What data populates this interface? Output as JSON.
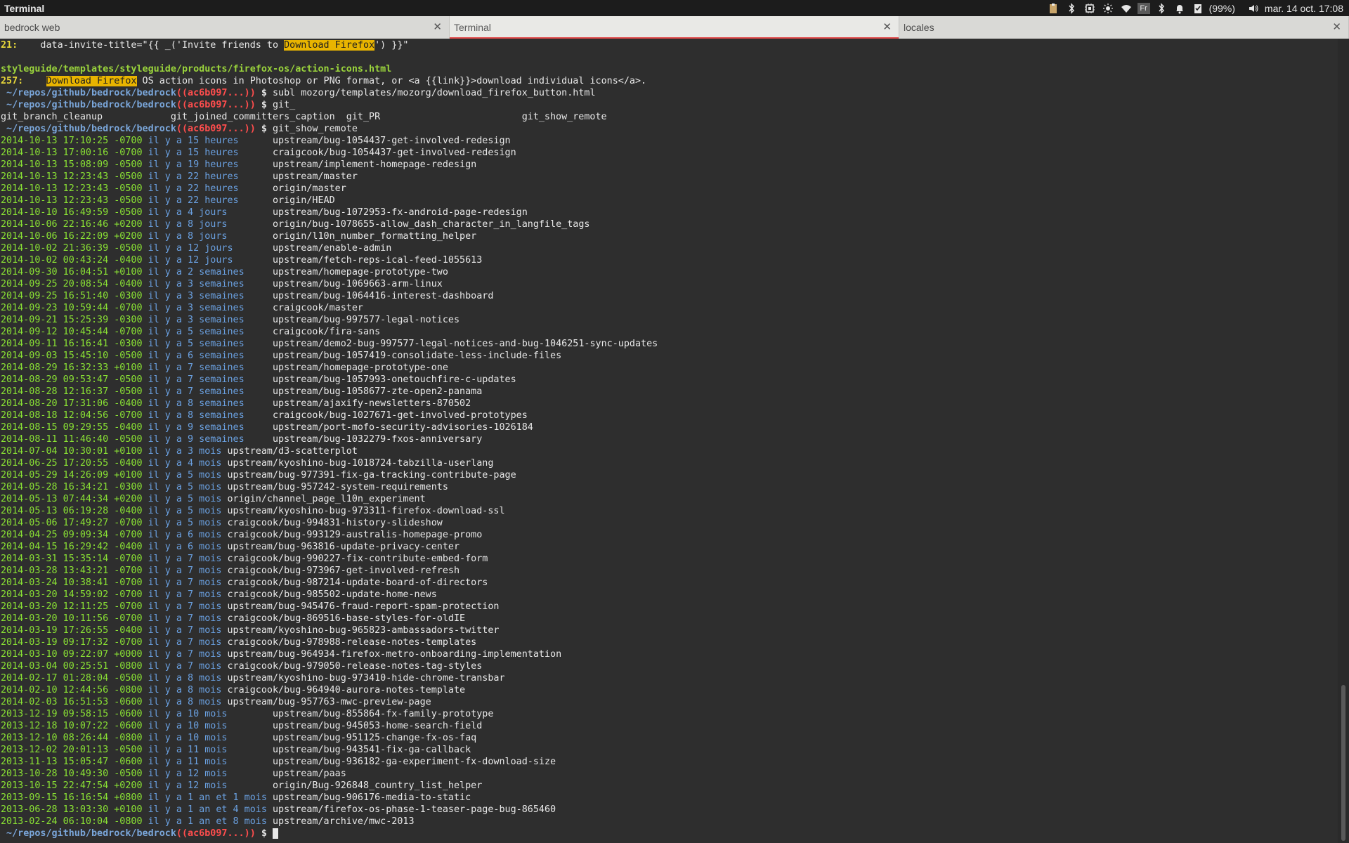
{
  "window": {
    "title": "Terminal"
  },
  "tray": {
    "battery": "(99%)",
    "datetime": "mar. 14 oct. 17:08",
    "keyboard_label": "Fr",
    "icons": [
      "clipboard-icon",
      "bluetooth-icon",
      "cpu-icon",
      "brightness-icon",
      "wifi-icon",
      "keyboard-layout-icon",
      "bluetooth-icon",
      "bell-icon",
      "checklist-icon",
      "battery-text",
      "volume-icon"
    ]
  },
  "tabs": [
    {
      "label": "bedrock web",
      "active": false
    },
    {
      "label": "Terminal",
      "active": true
    },
    {
      "label": "locales",
      "active": false
    }
  ],
  "terminal": {
    "lines": [
      {
        "kind": "grep",
        "num": "21:",
        "pre": "    data-invite-title=\"{{ _('Invite friends to ",
        "hl": "Download Firefox",
        "post": "') }}\""
      },
      {
        "kind": "blank"
      },
      {
        "kind": "file",
        "text": "styleguide/templates/styleguide/products/firefox-os/action-icons.html"
      },
      {
        "kind": "grep",
        "num": "257:",
        "pre": "    ",
        "hl": "Download Firefox",
        "post": " OS action icons in Photoshop or PNG format, or <a {{link}}>download individual icons</a>."
      },
      {
        "kind": "prompt",
        "path": " ~/repos/github/bedrock/bedrock",
        "branch": "((ac6b097...))",
        "cmd": " subl mozorg/templates/mozorg/download_firefox_button.html"
      },
      {
        "kind": "prompt",
        "path": " ~/repos/github/bedrock/bedrock",
        "branch": "((ac6b097...))",
        "cmd": " git_"
      },
      {
        "kind": "plain",
        "text": "git_branch_cleanup            git_joined_committers_caption  git_PR                         git_show_remote"
      },
      {
        "kind": "prompt",
        "path": " ~/repos/github/bedrock/bedrock",
        "branch": "((ac6b097...))",
        "cmd": " git_show_remote"
      },
      {
        "kind": "ref",
        "date": "2014-10-13 17:10:25 -0700",
        "rel": "il y a 15 heures",
        "pad": "      ",
        "branch": "upstream/bug-1054437-get-involved-redesign"
      },
      {
        "kind": "ref",
        "date": "2014-10-13 17:00:16 -0700",
        "rel": "il y a 15 heures",
        "pad": "      ",
        "branch": "craigcook/bug-1054437-get-involved-redesign"
      },
      {
        "kind": "ref",
        "date": "2014-10-13 15:08:09 -0500",
        "rel": "il y a 19 heures",
        "pad": "      ",
        "branch": "upstream/implement-homepage-redesign"
      },
      {
        "kind": "ref",
        "date": "2014-10-13 12:23:43 -0500",
        "rel": "il y a 22 heures",
        "pad": "      ",
        "branch": "upstream/master"
      },
      {
        "kind": "ref",
        "date": "2014-10-13 12:23:43 -0500",
        "rel": "il y a 22 heures",
        "pad": "      ",
        "branch": "origin/master"
      },
      {
        "kind": "ref",
        "date": "2014-10-13 12:23:43 -0500",
        "rel": "il y a 22 heures",
        "pad": "      ",
        "branch": "origin/HEAD"
      },
      {
        "kind": "ref",
        "date": "2014-10-10 16:49:59 -0500",
        "rel": "il y a 4 jours",
        "pad": "        ",
        "branch": "upstream/bug-1072953-fx-android-page-redesign"
      },
      {
        "kind": "ref",
        "date": "2014-10-06 22:16:46 +0200",
        "rel": "il y a 8 jours",
        "pad": "        ",
        "branch": "origin/bug-1078655-allow_dash_character_in_langfile_tags"
      },
      {
        "kind": "ref",
        "date": "2014-10-06 16:22:09 +0200",
        "rel": "il y a 8 jours",
        "pad": "        ",
        "branch": "origin/l10n_number_formatting_helper"
      },
      {
        "kind": "ref",
        "date": "2014-10-02 21:36:39 -0500",
        "rel": "il y a 12 jours",
        "pad": "       ",
        "branch": "upstream/enable-admin"
      },
      {
        "kind": "ref",
        "date": "2014-10-02 00:43:24 -0400",
        "rel": "il y a 12 jours",
        "pad": "       ",
        "branch": "upstream/fetch-reps-ical-feed-1055613"
      },
      {
        "kind": "ref",
        "date": "2014-09-30 16:04:51 +0100",
        "rel": "il y a 2 semaines",
        "pad": "     ",
        "branch": "upstream/homepage-prototype-two"
      },
      {
        "kind": "ref",
        "date": "2014-09-25 20:08:54 -0400",
        "rel": "il y a 3 semaines",
        "pad": "     ",
        "branch": "upstream/bug-1069663-arm-linux"
      },
      {
        "kind": "ref",
        "date": "2014-09-25 16:51:40 -0300",
        "rel": "il y a 3 semaines",
        "pad": "     ",
        "branch": "upstream/bug-1064416-interest-dashboard"
      },
      {
        "kind": "ref",
        "date": "2014-09-23 10:59:44 -0700",
        "rel": "il y a 3 semaines",
        "pad": "     ",
        "branch": "craigcook/master"
      },
      {
        "kind": "ref",
        "date": "2014-09-21 15:25:39 -0300",
        "rel": "il y a 3 semaines",
        "pad": "     ",
        "branch": "upstream/bug-997577-legal-notices"
      },
      {
        "kind": "ref",
        "date": "2014-09-12 10:45:44 -0700",
        "rel": "il y a 5 semaines",
        "pad": "     ",
        "branch": "craigcook/fira-sans"
      },
      {
        "kind": "ref",
        "date": "2014-09-11 16:16:41 -0300",
        "rel": "il y a 5 semaines",
        "pad": "     ",
        "branch": "upstream/demo2-bug-997577-legal-notices-and-bug-1046251-sync-updates"
      },
      {
        "kind": "ref",
        "date": "2014-09-03 15:45:10 -0500",
        "rel": "il y a 6 semaines",
        "pad": "     ",
        "branch": "upstream/bug-1057419-consolidate-less-include-files"
      },
      {
        "kind": "ref",
        "date": "2014-08-29 16:32:33 +0100",
        "rel": "il y a 7 semaines",
        "pad": "     ",
        "branch": "upstream/homepage-prototype-one"
      },
      {
        "kind": "ref",
        "date": "2014-08-29 09:53:47 -0500",
        "rel": "il y a 7 semaines",
        "pad": "     ",
        "branch": "upstream/bug-1057993-onetouchfire-c-updates"
      },
      {
        "kind": "ref",
        "date": "2014-08-28 12:16:37 -0500",
        "rel": "il y a 7 semaines",
        "pad": "     ",
        "branch": "upstream/bug-1058677-zte-open2-panama"
      },
      {
        "kind": "ref",
        "date": "2014-08-20 17:31:06 -0400",
        "rel": "il y a 8 semaines",
        "pad": "     ",
        "branch": "upstream/ajaxify-newsletters-870502"
      },
      {
        "kind": "ref",
        "date": "2014-08-18 12:04:56 -0700",
        "rel": "il y a 8 semaines",
        "pad": "     ",
        "branch": "craigcook/bug-1027671-get-involved-prototypes"
      },
      {
        "kind": "ref",
        "date": "2014-08-15 09:29:55 -0400",
        "rel": "il y a 9 semaines",
        "pad": "     ",
        "branch": "upstream/port-mofo-security-advisories-1026184"
      },
      {
        "kind": "ref",
        "date": "2014-08-11 11:46:40 -0500",
        "rel": "il y a 9 semaines",
        "pad": "     ",
        "branch": "upstream/bug-1032279-fxos-anniversary"
      },
      {
        "kind": "ref",
        "date": "2014-07-04 10:30:01 +0100",
        "rel": "il y a 3 mois",
        "pad": " ",
        "branch": "upstream/d3-scatterplot"
      },
      {
        "kind": "ref",
        "date": "2014-06-25 17:20:55 -0400",
        "rel": "il y a 4 mois",
        "pad": " ",
        "branch": "upstream/kyoshino-bug-1018724-tabzilla-userlang"
      },
      {
        "kind": "ref",
        "date": "2014-05-29 14:26:09 +0100",
        "rel": "il y a 5 mois",
        "pad": " ",
        "branch": "upstream/bug-977391-fix-ga-tracking-contribute-page"
      },
      {
        "kind": "ref",
        "date": "2014-05-28 16:34:21 -0300",
        "rel": "il y a 5 mois",
        "pad": " ",
        "branch": "upstream/bug-957242-system-requirements"
      },
      {
        "kind": "ref",
        "date": "2014-05-13 07:44:34 +0200",
        "rel": "il y a 5 mois",
        "pad": " ",
        "branch": "origin/channel_page_l10n_experiment"
      },
      {
        "kind": "ref",
        "date": "2014-05-13 06:19:28 -0400",
        "rel": "il y a 5 mois",
        "pad": " ",
        "branch": "upstream/kyoshino-bug-973311-firefox-download-ssl"
      },
      {
        "kind": "ref",
        "date": "2014-05-06 17:49:27 -0700",
        "rel": "il y a 5 mois",
        "pad": " ",
        "branch": "craigcook/bug-994831-history-slideshow"
      },
      {
        "kind": "ref",
        "date": "2014-04-25 09:09:34 -0700",
        "rel": "il y a 6 mois",
        "pad": " ",
        "branch": "craigcook/bug-993129-australis-homepage-promo"
      },
      {
        "kind": "ref",
        "date": "2014-04-15 16:29:42 -0400",
        "rel": "il y a 6 mois",
        "pad": " ",
        "branch": "upstream/bug-963816-update-privacy-center"
      },
      {
        "kind": "ref",
        "date": "2014-03-31 15:35:14 -0700",
        "rel": "il y a 7 mois",
        "pad": " ",
        "branch": "craigcook/bug-990227-fix-contribute-embed-form"
      },
      {
        "kind": "ref",
        "date": "2014-03-28 13:43:21 -0700",
        "rel": "il y a 7 mois",
        "pad": " ",
        "branch": "craigcook/bug-973967-get-involved-refresh"
      },
      {
        "kind": "ref",
        "date": "2014-03-24 10:38:41 -0700",
        "rel": "il y a 7 mois",
        "pad": " ",
        "branch": "craigcook/bug-987214-update-board-of-directors"
      },
      {
        "kind": "ref",
        "date": "2014-03-20 14:59:02 -0700",
        "rel": "il y a 7 mois",
        "pad": " ",
        "branch": "craigcook/bug-985502-update-home-news"
      },
      {
        "kind": "ref",
        "date": "2014-03-20 12:11:25 -0700",
        "rel": "il y a 7 mois",
        "pad": " ",
        "branch": "upstream/bug-945476-fraud-report-spam-protection"
      },
      {
        "kind": "ref",
        "date": "2014-03-20 10:11:56 -0700",
        "rel": "il y a 7 mois",
        "pad": " ",
        "branch": "craigcook/bug-869516-base-styles-for-oldIE"
      },
      {
        "kind": "ref",
        "date": "2014-03-19 17:26:55 -0400",
        "rel": "il y a 7 mois",
        "pad": " ",
        "branch": "upstream/kyoshino-bug-965823-ambassadors-twitter"
      },
      {
        "kind": "ref",
        "date": "2014-03-19 09:17:32 -0700",
        "rel": "il y a 7 mois",
        "pad": " ",
        "branch": "craigcook/bug-978988-release-notes-templates"
      },
      {
        "kind": "ref",
        "date": "2014-03-10 09:22:07 +0000",
        "rel": "il y a 7 mois",
        "pad": " ",
        "branch": "upstream/bug-964934-firefox-metro-onboarding-implementation"
      },
      {
        "kind": "ref",
        "date": "2014-03-04 00:25:51 -0800",
        "rel": "il y a 7 mois",
        "pad": " ",
        "branch": "craigcook/bug-979050-release-notes-tag-styles"
      },
      {
        "kind": "ref",
        "date": "2014-02-17 01:28:04 -0500",
        "rel": "il y a 8 mois",
        "pad": " ",
        "branch": "upstream/kyoshino-bug-973410-hide-chrome-transbar"
      },
      {
        "kind": "ref",
        "date": "2014-02-10 12:44:56 -0800",
        "rel": "il y a 8 mois",
        "pad": " ",
        "branch": "craigcook/bug-964940-aurora-notes-template"
      },
      {
        "kind": "ref",
        "date": "2014-02-03 16:51:53 -0600",
        "rel": "il y a 8 mois",
        "pad": " ",
        "branch": "upstream/bug-957763-mwc-preview-page"
      },
      {
        "kind": "ref",
        "date": "2013-12-19 09:58:15 -0600",
        "rel": "il y a 10 mois",
        "pad": "        ",
        "branch": "upstream/bug-855864-fx-family-prototype"
      },
      {
        "kind": "ref",
        "date": "2013-12-18 10:07:22 -0600",
        "rel": "il y a 10 mois",
        "pad": "        ",
        "branch": "upstream/bug-945053-home-search-field"
      },
      {
        "kind": "ref",
        "date": "2013-12-10 08:26:44 -0800",
        "rel": "il y a 10 mois",
        "pad": "        ",
        "branch": "upstream/bug-951125-change-fx-os-faq"
      },
      {
        "kind": "ref",
        "date": "2013-12-02 20:01:13 -0500",
        "rel": "il y a 11 mois",
        "pad": "        ",
        "branch": "upstream/bug-943541-fix-ga-callback"
      },
      {
        "kind": "ref",
        "date": "2013-11-13 15:05:47 -0600",
        "rel": "il y a 11 mois",
        "pad": "        ",
        "branch": "upstream/bug-936182-ga-experiment-fx-download-size"
      },
      {
        "kind": "ref",
        "date": "2013-10-28 10:49:30 -0500",
        "rel": "il y a 12 mois",
        "pad": "        ",
        "branch": "upstream/paas"
      },
      {
        "kind": "ref",
        "date": "2013-10-15 22:47:54 +0200",
        "rel": "il y a 12 mois",
        "pad": "        ",
        "branch": "origin/Bug-926848_country_list_helper"
      },
      {
        "kind": "ref",
        "date": "2013-09-15 16:16:54 +0800",
        "rel": "il y a 1 an et 1 mois",
        "pad": " ",
        "branch": "upstream/bug-906176-media-to-static"
      },
      {
        "kind": "ref",
        "date": "2013-06-28 13:03:30 +0100",
        "rel": "il y a 1 an et 4 mois",
        "pad": " ",
        "branch": "upstream/firefox-os-phase-1-teaser-page-bug-865460"
      },
      {
        "kind": "ref",
        "date": "2013-02-24 06:10:04 -0800",
        "rel": "il y a 1 an et 8 mois",
        "pad": " ",
        "branch": "upstream/archive/mwc-2013"
      },
      {
        "kind": "prompt",
        "path": " ~/repos/github/bedrock/bedrock",
        "branch": "((ac6b097...))",
        "cmd": " ",
        "cursor": true
      }
    ]
  }
}
